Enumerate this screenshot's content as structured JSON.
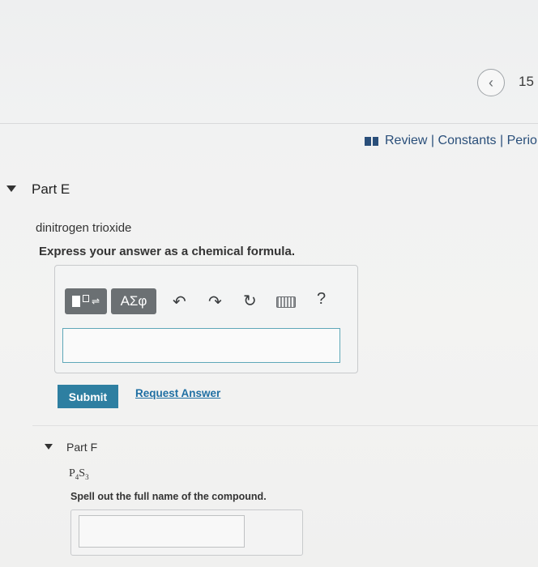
{
  "header": {
    "prev_icon": "chevron-left-icon",
    "page_number": "15"
  },
  "resources": {
    "icon": "book-icon",
    "text": "Review | Constants | Perio"
  },
  "part_e": {
    "title": "Part E",
    "question": "dinitrogen trioxide",
    "instruction": "Express your answer as a chemical formula.",
    "toolbar": {
      "template_icon": "template-icon",
      "greek_label": "ΑΣφ",
      "undo_icon": "undo-icon",
      "redo_icon": "redo-icon",
      "reset_icon": "reset-icon",
      "keyboard_icon": "keyboard-icon",
      "help_label": "?"
    },
    "answer_value": "",
    "submit_label": "Submit",
    "request_label": "Request Answer"
  },
  "part_f": {
    "title": "Part F",
    "formula": {
      "p": "P",
      "p_sub": "4",
      "s": "S",
      "s_sub": "3"
    },
    "instruction": "Spell out the full name of the compound.",
    "answer_value": ""
  }
}
